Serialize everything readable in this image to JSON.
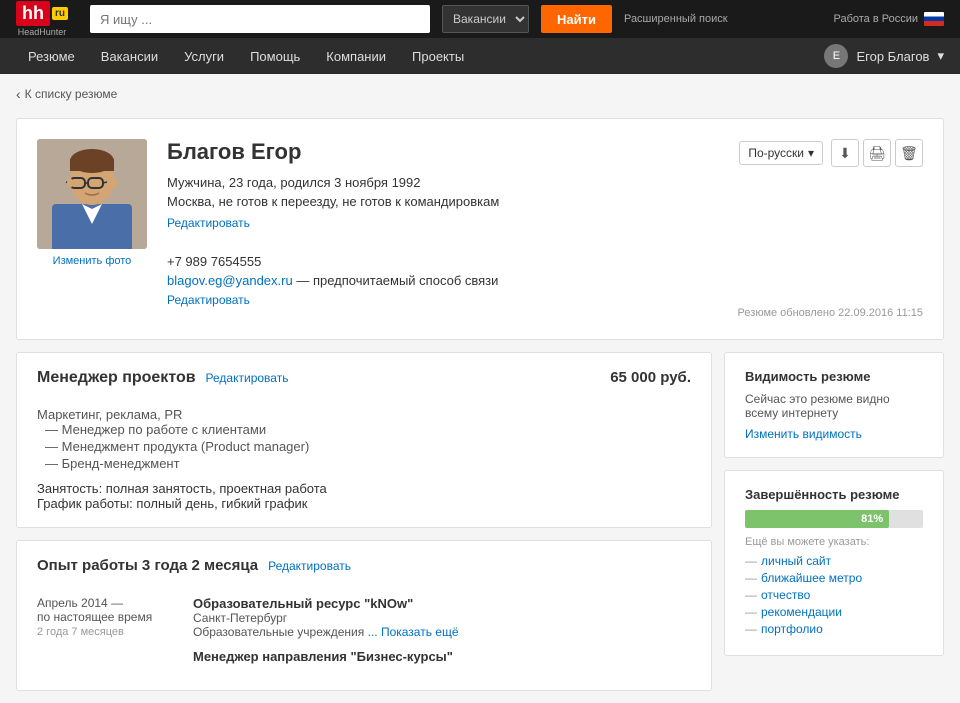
{
  "topbar": {
    "logo_hh": "hh",
    "logo_ru": "ru",
    "logo_sub": "HeadHunter",
    "search_placeholder": "Я ищу ...",
    "vacancies_label": "Вакансии",
    "search_btn": "Найти",
    "advanced_label": "Расширенный поиск",
    "work_in_russia": "Работа в России"
  },
  "mainnav": {
    "items": [
      {
        "label": "Резюме"
      },
      {
        "label": "Вакансии"
      },
      {
        "label": "Услуги"
      },
      {
        "label": "Помощь"
      },
      {
        "label": "Компании"
      },
      {
        "label": "Проекты"
      }
    ],
    "user": "Егор Благов"
  },
  "breadcrumb": "К списку резюме",
  "resume": {
    "name": "Благов Егор",
    "meta": "Мужчина, 23 года, родился 3 ноября 1992",
    "location": "Москва, не готов к переезду, не готов к командировкам",
    "edit_label": "Редактировать",
    "phone": "+7 989 7654555",
    "email": "blagov.eg@yandex.ru",
    "email_suffix": " — предпочитаемый способ связи",
    "edit_contact": "Редактировать",
    "change_photo": "Изменить фото",
    "lang_selector": "По-русски",
    "updated": "Резюме обновлено 22.09.2016 11:15",
    "download_icon": "⬇",
    "print_icon": "🖨",
    "delete_icon": "🗑"
  },
  "job": {
    "title": "Менеджер проектов",
    "edit_label": "Редактировать",
    "salary": "65 000 руб.",
    "category": "Маркетинг, реклама, PR",
    "specs": [
      "— Менеджер по работе с клиентами",
      "— Менеджмент продукта (Product manager)",
      "— Бренд-менеджмент"
    ],
    "employment": "Занятость: полная занятость, проектная работа",
    "schedule": "График работы: полный день, гибкий график"
  },
  "experience": {
    "title": "Опыт работы 3 года 2 месяца",
    "edit_label": "Редактировать",
    "items": [
      {
        "dates": "Апрель 2014 —\nпо настоящее время",
        "duration": "2 года 7 месяцев",
        "company": "Образовательный ресурс \"kNOw\"",
        "city": "Санкт-Петербург",
        "type": "Образовательные учреждения",
        "show_more": "... Показать ещё"
      },
      {
        "company2": "Менеджер направления \"Бизнес-курсы\""
      }
    ]
  },
  "sidebar": {
    "visibility": {
      "title": "Видимость резюме",
      "text": "Сейчас это резюме видно всему интернету",
      "change_label": "Изменить видимость"
    },
    "completion": {
      "title": "Завершённость резюме",
      "percent": 81,
      "percent_label": "81%",
      "can_add_title": "Ещё вы можете указать:",
      "items": [
        "— личный сайт",
        "— ближайшее метро",
        "— отчество",
        "— рекомендации",
        "— портфолио"
      ]
    }
  }
}
